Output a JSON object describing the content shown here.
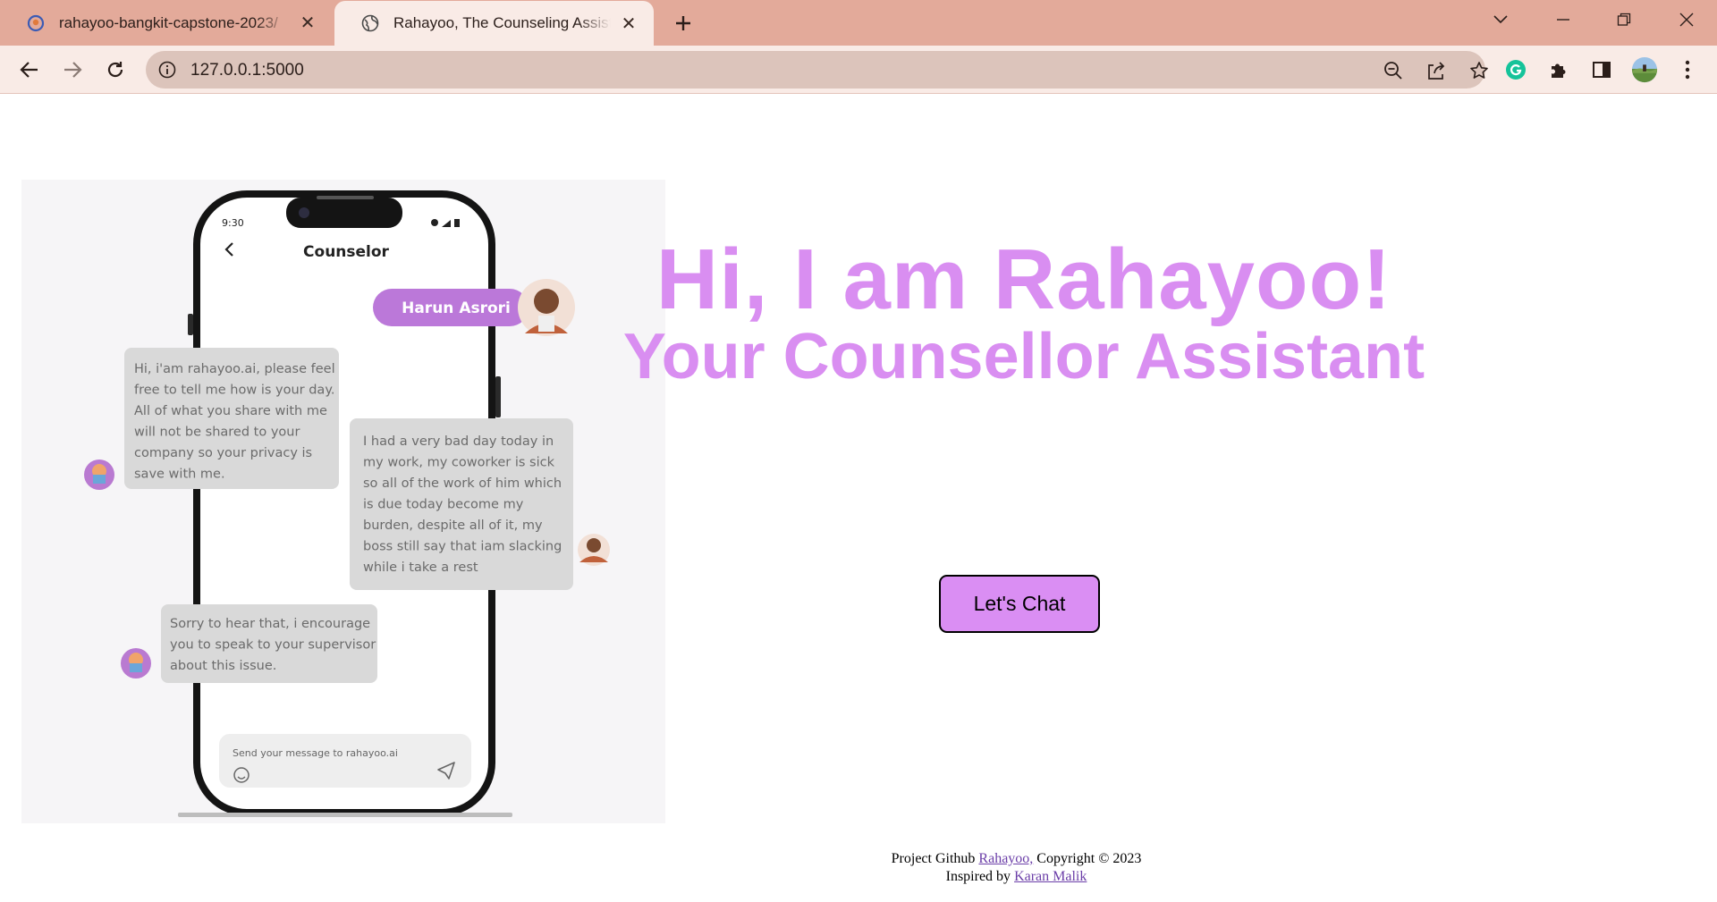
{
  "browser": {
    "tabs": [
      {
        "title": "rahayoo-bangkit-capstone-2023/",
        "active": false,
        "icon": "github-icon"
      },
      {
        "title": "Rahayoo, The Counseling Assistant",
        "active": true,
        "icon": "globe-icon"
      }
    ],
    "url": "127.0.0.1:5000"
  },
  "page": {
    "heading": "Hi, I am Rahayoo!",
    "subheading": "Your Counsellor Assistant",
    "cta_label": "Let's Chat",
    "illustration": {
      "status_time": "9:30",
      "screen_title": "Counselor",
      "user_name": "Harun Asrori",
      "messages": [
        {
          "from": "bot",
          "lines": [
            "Hi, i'am rahayoo.ai, please feel",
            "free to tell me how is your day.",
            "All of what you share with me",
            "will not be shared to your",
            "company so your privacy is",
            "save with me."
          ]
        },
        {
          "from": "user",
          "lines": [
            "I had a very bad day today in",
            "my work, my coworker is sick",
            "so all of the work of him which",
            "is due today become my",
            "burden, despite all of it, my",
            "boss still say that iam slacking",
            "while i take a rest"
          ]
        },
        {
          "from": "bot",
          "lines": [
            "Sorry to hear that, i encourage",
            "you to speak to your supervisor",
            "about this issue."
          ]
        }
      ],
      "input_placeholder": "Send your message to rahayoo.ai"
    },
    "footer": {
      "line1_prefix": "Project Github ",
      "project_link": "Rahayoo,",
      "line1_suffix": " Copyright © 2023",
      "line2_prefix": "Inspired by ",
      "author_link": "Karan Malik"
    }
  },
  "colors": {
    "accent": "#da8ef3",
    "chrome_tabbar": "#e3aa9a",
    "chrome_toolbar": "#f9ebe6"
  }
}
